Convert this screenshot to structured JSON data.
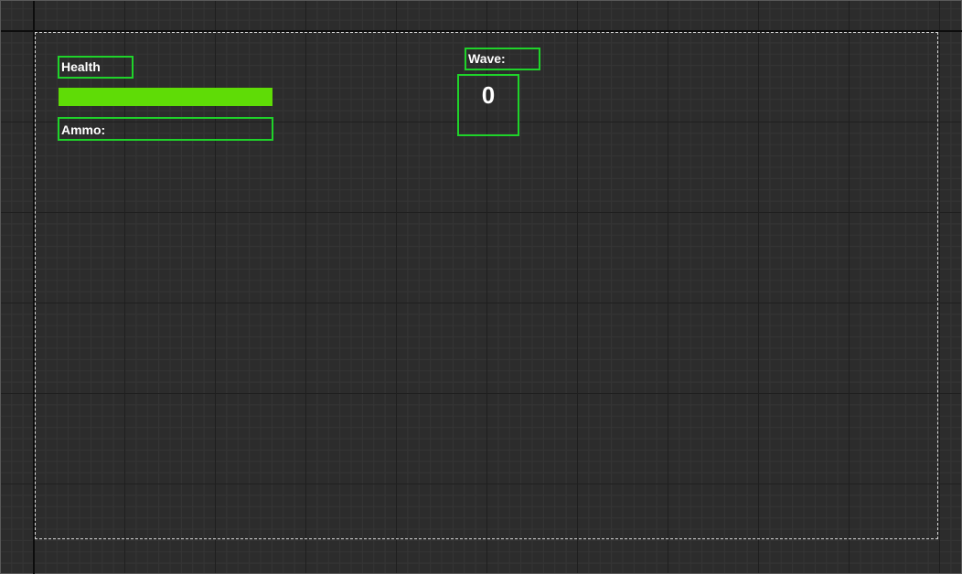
{
  "hud": {
    "health_label": "Health",
    "health_fraction": 1.0,
    "ammo_label": "Ammo:",
    "wave_label": "Wave:",
    "wave_value": "0"
  },
  "colors": {
    "widget_outline": "#1fd32a",
    "health_fill": "#5fdc06",
    "canvas_background": "#2c2c2c",
    "safe_zone_border": "#d8d8d8"
  }
}
